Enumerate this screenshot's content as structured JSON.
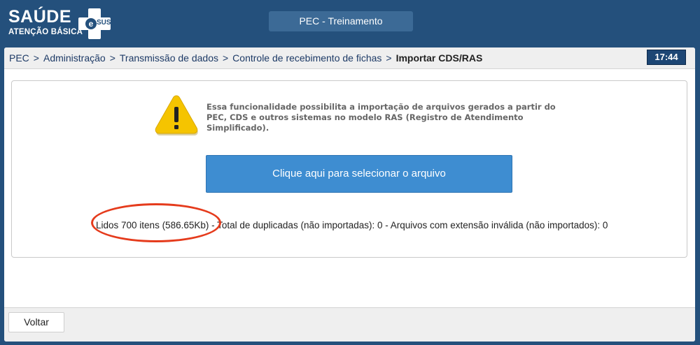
{
  "logo": {
    "main": "SAÚDE",
    "sub": "ATENÇÃO BÁSICA",
    "badge_letter": "e",
    "badge_text": "SUS"
  },
  "environment": {
    "label": "PEC - Treinamento"
  },
  "breadcrumb": {
    "items": [
      "PEC",
      "Administração",
      "Transmissão de dados",
      "Controle de recebimento de fichas"
    ],
    "separator": ">",
    "current": "Importar CDS/RAS"
  },
  "clock": {
    "time": "17:44"
  },
  "import_panel": {
    "warning_icon": "warning-triangle-icon",
    "info_text": "Essa funcionalidade possibilita a importação de arquivos gerados a partir do PEC, CDS e outros sistemas no modelo RAS (Registro de Atendimento Simplificado).",
    "select_button_label": "Clique aqui para selecionar o arquivo",
    "status": "Lidos 700 itens (586.65Kb) - Total de duplicadas (não importadas): 0 - Arquivos com extensão inválida (não importados): 0"
  },
  "footer": {
    "back_label": "Voltar"
  },
  "colors": {
    "header_bg": "#24507c",
    "primary_button": "#3e8dd1",
    "highlight_ring": "#e53b1c",
    "warning_yellow": "#f5c400"
  }
}
